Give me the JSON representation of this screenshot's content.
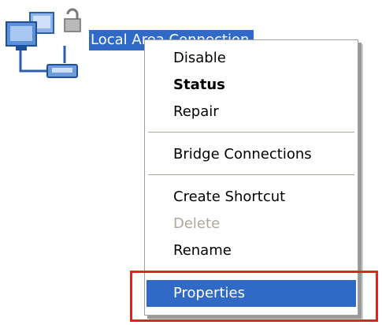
{
  "desktop": {
    "connection": {
      "icon": "network-connection-icon",
      "label": "Local Area Connection"
    }
  },
  "context_menu": {
    "items": [
      {
        "label": "Disable",
        "style": "normal"
      },
      {
        "label": "Status",
        "style": "bold"
      },
      {
        "label": "Repair",
        "style": "normal"
      },
      {
        "label": "Bridge Connections",
        "style": "normal"
      },
      {
        "label": "Create Shortcut",
        "style": "normal"
      },
      {
        "label": "Delete",
        "style": "disabled"
      },
      {
        "label": "Rename",
        "style": "normal"
      },
      {
        "label": "Properties",
        "style": "highlighted"
      }
    ]
  },
  "colors": {
    "selection": "#3169c6",
    "disabled_text": "#aca899",
    "annotation_box": "#e4231f"
  }
}
